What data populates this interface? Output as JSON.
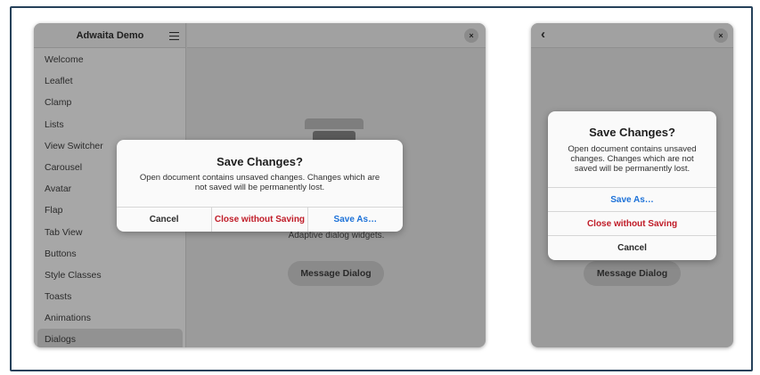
{
  "window_main": {
    "title": "Adwaita Demo",
    "sidebar_items": [
      {
        "label": "Welcome"
      },
      {
        "label": "Leaflet"
      },
      {
        "label": "Clamp"
      },
      {
        "label": "Lists"
      },
      {
        "label": "View Switcher"
      },
      {
        "label": "Carousel"
      },
      {
        "label": "Avatar"
      },
      {
        "label": "Flap"
      },
      {
        "label": "Tab View"
      },
      {
        "label": "Buttons"
      },
      {
        "label": "Style Classes"
      },
      {
        "label": "Toasts"
      },
      {
        "label": "Animations"
      },
      {
        "label": "Dialogs",
        "selected": true
      }
    ],
    "close_glyph": "×",
    "page_description": "Adaptive dialog widgets.",
    "message_dialog_button": "Message Dialog"
  },
  "dialog_wide": {
    "heading": "Save Changes?",
    "body": "Open document contains unsaved changes. Changes which are not saved will be permanently lost.",
    "actions": [
      {
        "label": "Cancel",
        "style": "normal"
      },
      {
        "label": "Close without Saving",
        "style": "destructive"
      },
      {
        "label": "Save As…",
        "style": "suggested"
      }
    ]
  },
  "window_narrow": {
    "back_glyph": "‹",
    "close_glyph": "×",
    "message_dialog_button": "Message Dialog"
  },
  "dialog_narrow": {
    "heading": "Save Changes?",
    "body": "Open document contains unsaved changes. Changes which are not saved will be permanently lost.",
    "actions": [
      {
        "label": "Save As…",
        "style": "suggested"
      },
      {
        "label": "Close without Saving",
        "style": "destructive"
      },
      {
        "label": "Cancel",
        "style": "normal"
      }
    ]
  },
  "colors": {
    "suggested": "#1c71d8",
    "destructive": "#c01c28",
    "frame_border": "#26415a"
  }
}
